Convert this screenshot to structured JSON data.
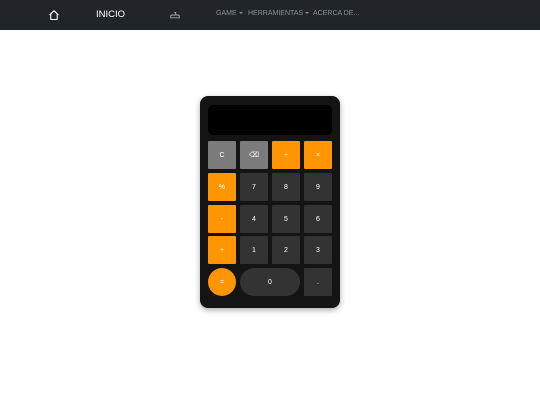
{
  "navbar": {
    "home_icon": "home-icon",
    "brand": "INICIO",
    "game_icon": "gamepad-icon",
    "links": [
      {
        "label": "GAME",
        "dropdown": true
      },
      {
        "label": "HERRAMIENTAS",
        "dropdown": true
      },
      {
        "label": "ACERCA DE...",
        "dropdown": false
      }
    ]
  },
  "calculator": {
    "display_value": "",
    "keys": {
      "clear": "C",
      "backspace": "⌫",
      "divide": "÷",
      "multiply": "×",
      "percent": "%",
      "seven": "7",
      "eight": "8",
      "nine": "9",
      "minus": "-",
      "four": "4",
      "five": "5",
      "six": "6",
      "plus": "+",
      "one": "1",
      "two": "2",
      "three": "3",
      "equals": "=",
      "zero": "0",
      "decimal": "."
    }
  },
  "colors": {
    "navbar_bg": "#212529",
    "accent_orange": "#ff9500",
    "key_gray": "#7b7b7b",
    "key_dark": "#333333",
    "calculator_body": "#141414"
  }
}
